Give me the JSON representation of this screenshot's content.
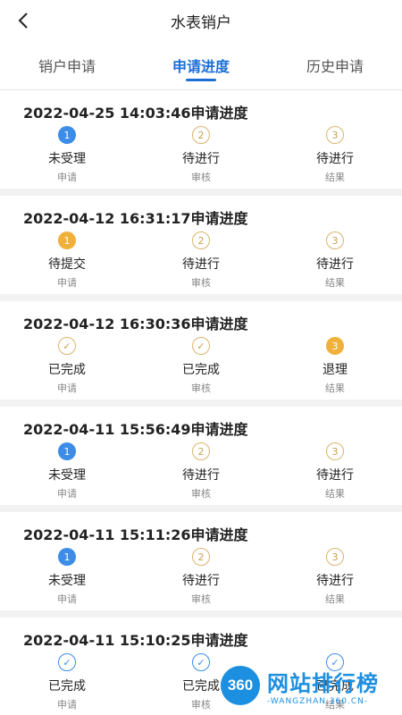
{
  "header": {
    "title": "水表销户",
    "back_icon": "chevron-left-icon"
  },
  "tabs": [
    {
      "label": "销户申请",
      "active": false
    },
    {
      "label": "申请进度",
      "active": true
    },
    {
      "label": "历史申请",
      "active": false
    }
  ],
  "records": [
    {
      "title": "2022-04-25 14:03:46申请进度",
      "steps": [
        {
          "badge": "1",
          "status": "未受理",
          "sub": "申请",
          "style": "blue"
        },
        {
          "badge": "2",
          "status": "待进行",
          "sub": "审核",
          "style": "outline"
        },
        {
          "badge": "3",
          "status": "待进行",
          "sub": "结果",
          "style": "outline"
        }
      ]
    },
    {
      "title": "2022-04-12 16:31:17申请进度",
      "steps": [
        {
          "badge": "1",
          "status": "待提交",
          "sub": "申请",
          "style": "orange"
        },
        {
          "badge": "2",
          "status": "待进行",
          "sub": "审核",
          "style": "outline"
        },
        {
          "badge": "3",
          "status": "待进行",
          "sub": "结果",
          "style": "outline"
        }
      ]
    },
    {
      "title": "2022-04-12 16:30:36申请进度",
      "steps": [
        {
          "badge": "✓",
          "status": "已完成",
          "sub": "申请",
          "style": "outline"
        },
        {
          "badge": "✓",
          "status": "已完成",
          "sub": "审核",
          "style": "outline"
        },
        {
          "badge": "3",
          "status": "退理",
          "sub": "结果",
          "style": "orange"
        }
      ]
    },
    {
      "title": "2022-04-11 15:56:49申请进度",
      "steps": [
        {
          "badge": "1",
          "status": "未受理",
          "sub": "申请",
          "style": "blue"
        },
        {
          "badge": "2",
          "status": "待进行",
          "sub": "审核",
          "style": "outline"
        },
        {
          "badge": "3",
          "status": "待进行",
          "sub": "结果",
          "style": "outline"
        }
      ]
    },
    {
      "title": "2022-04-11 15:11:26申请进度",
      "steps": [
        {
          "badge": "1",
          "status": "未受理",
          "sub": "申请",
          "style": "blue"
        },
        {
          "badge": "2",
          "status": "待进行",
          "sub": "审核",
          "style": "outline"
        },
        {
          "badge": "3",
          "status": "待进行",
          "sub": "结果",
          "style": "outline"
        }
      ]
    },
    {
      "title": "2022-04-11 15:10:25申请进度",
      "steps": [
        {
          "badge": "✓",
          "status": "已完成",
          "sub": "申请",
          "style": "outline-blue"
        },
        {
          "badge": "✓",
          "status": "已完成",
          "sub": "审核",
          "style": "outline-blue"
        },
        {
          "badge": "✓",
          "status": "已完成",
          "sub": "结果",
          "style": "outline-blue"
        }
      ]
    }
  ],
  "watermark": {
    "logo_text": "360",
    "main": "网站排行榜",
    "sub": "-WANGZHAN.360.CN-"
  },
  "colors": {
    "accent": "#1d6fd6",
    "blue": "#3b8de8",
    "orange": "#f0b13b",
    "outline": "#d9b56c"
  }
}
